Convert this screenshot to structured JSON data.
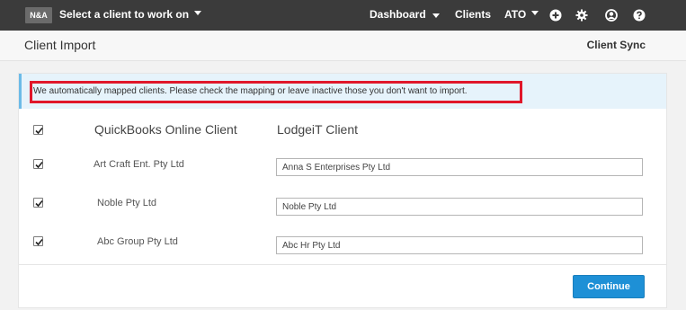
{
  "topbar": {
    "logo": "N&A",
    "client_select": "Select a client to work on",
    "nav": {
      "dashboard": "Dashboard",
      "clients": "Clients",
      "ato": "ATO"
    },
    "icons": [
      "plus-circle-icon",
      "gear-icon",
      "user-icon",
      "help-icon"
    ],
    "background_color": "#3b3b3b"
  },
  "subheader": {
    "title": "Client Import",
    "client_sync": "Client Sync"
  },
  "info": {
    "message": "We automatically mapped clients. Please check the mapping or leave inactive those you don't want to import.",
    "highlight_color": "#e0172a"
  },
  "table": {
    "header_checked": true,
    "headers": {
      "qbo": "QuickBooks Online Client",
      "lodgeit": "LodgeiT Client"
    },
    "rows": [
      {
        "checked": true,
        "qbo_client": "Art Craft Ent. Pty Ltd",
        "lodgeit_client": "Anna S Enterprises Pty Ltd"
      },
      {
        "checked": true,
        "qbo_client": "Noble Pty Ltd",
        "lodgeit_client": "Noble Pty Ltd"
      },
      {
        "checked": true,
        "qbo_client": "Abc Group Pty Ltd",
        "lodgeit_client": "Abc Hr Pty Ltd"
      }
    ]
  },
  "actions": {
    "continue_label": "Continue",
    "accent_color": "#1e90d6"
  }
}
